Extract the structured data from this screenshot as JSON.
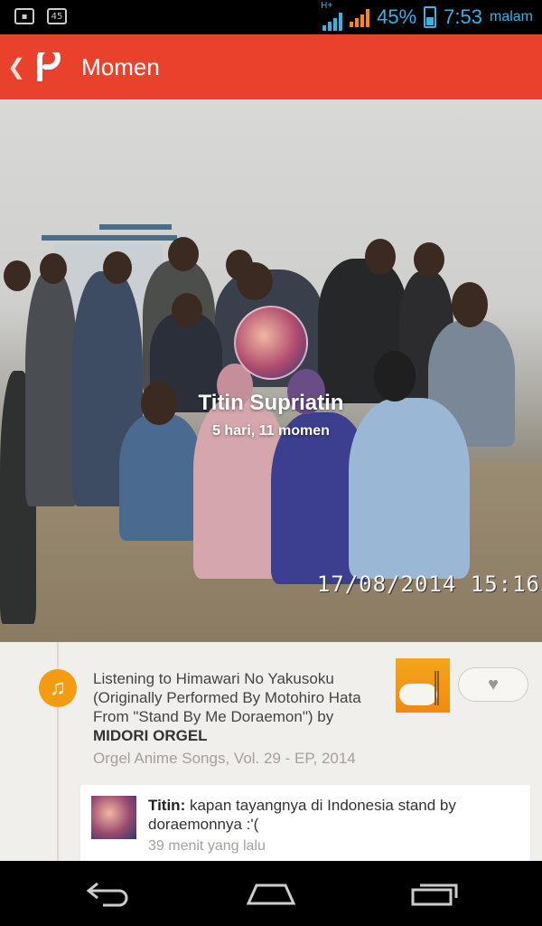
{
  "status_bar": {
    "network_type": "H+",
    "battery_percent": "45%",
    "time": "7:53",
    "ampm": "malam",
    "left_icons": [
      "bbm-icon",
      "sim-45-icon"
    ],
    "sim_label": "45"
  },
  "app_bar": {
    "title": "Momen",
    "accent_color": "#e8412c"
  },
  "profile": {
    "name": "Titin Supriatin",
    "summary": "5 hari, 11 momen",
    "photo_timestamp": "17/08/2014  15:16"
  },
  "moment": {
    "icon": "music-note-icon",
    "text": "Listening to Himawari No Yakusoku (Originally Performed By Motohiro Hata From \"Stand By Me Doraemon\") by",
    "artist": "MIDORI ORGEL",
    "album": "Orgel Anime Songs, Vol. 29 - EP, 2014"
  },
  "comment": {
    "author": "Titin:",
    "text": "kapan tayangnya di Indonesia stand by doraemonnya  :'(",
    "time": "39 menit yang lalu"
  },
  "nav": {
    "buttons": [
      "back-icon",
      "home-icon",
      "recent-apps-icon"
    ]
  }
}
